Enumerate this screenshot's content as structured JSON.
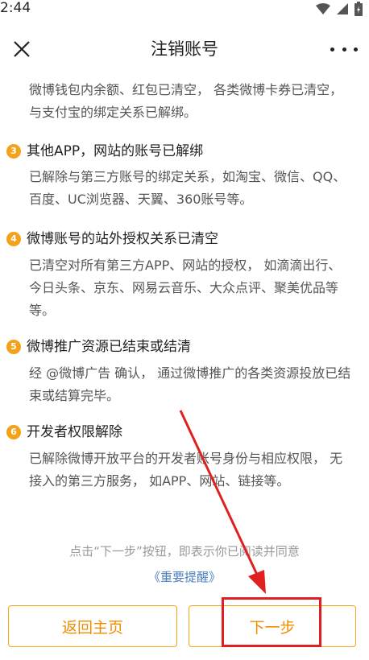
{
  "status_bar": {
    "time": "2:44"
  },
  "nav": {
    "title": "注销账号"
  },
  "intro_text": "微博钱包内余额、红包已清空， 各类微博卡券已清空， 与支付宝的绑定关系已解绑。",
  "items": [
    {
      "num": "3",
      "title": "其他APP，网站的账号已解绑",
      "desc": "已解除与第三方账号的绑定关系，如淘宝、微信、QQ、百度、UC浏览器、天翼、360账号等。"
    },
    {
      "num": "4",
      "title": "微博账号的站外授权关系已清空",
      "desc": "已清空对所有第三方APP、网站的授权， 如滴滴出行、今日头条、京东、网易云音乐、大众点评、聚美优品等等。"
    },
    {
      "num": "5",
      "title": "微博推广资源已结束或结清",
      "desc": "经 @微博广告 确认， 通过微博推广的各类资源投放已结束或结算完毕。"
    },
    {
      "num": "6",
      "title": "开发者权限解除",
      "desc": "已解除微博开放平台的开发者账号身份与相应权限， 无接入的第三方服务， 如APP、网站、链接等。"
    }
  ],
  "footer": {
    "note": "点击“下一步”按钮，即表示你已阅读并同意",
    "link": "《重要提醒》"
  },
  "buttons": {
    "back": "返回主页",
    "next": "下一步"
  },
  "colors": {
    "accent": "#f5a21b",
    "annotation": "#e02020",
    "link": "#4a7fbf"
  }
}
